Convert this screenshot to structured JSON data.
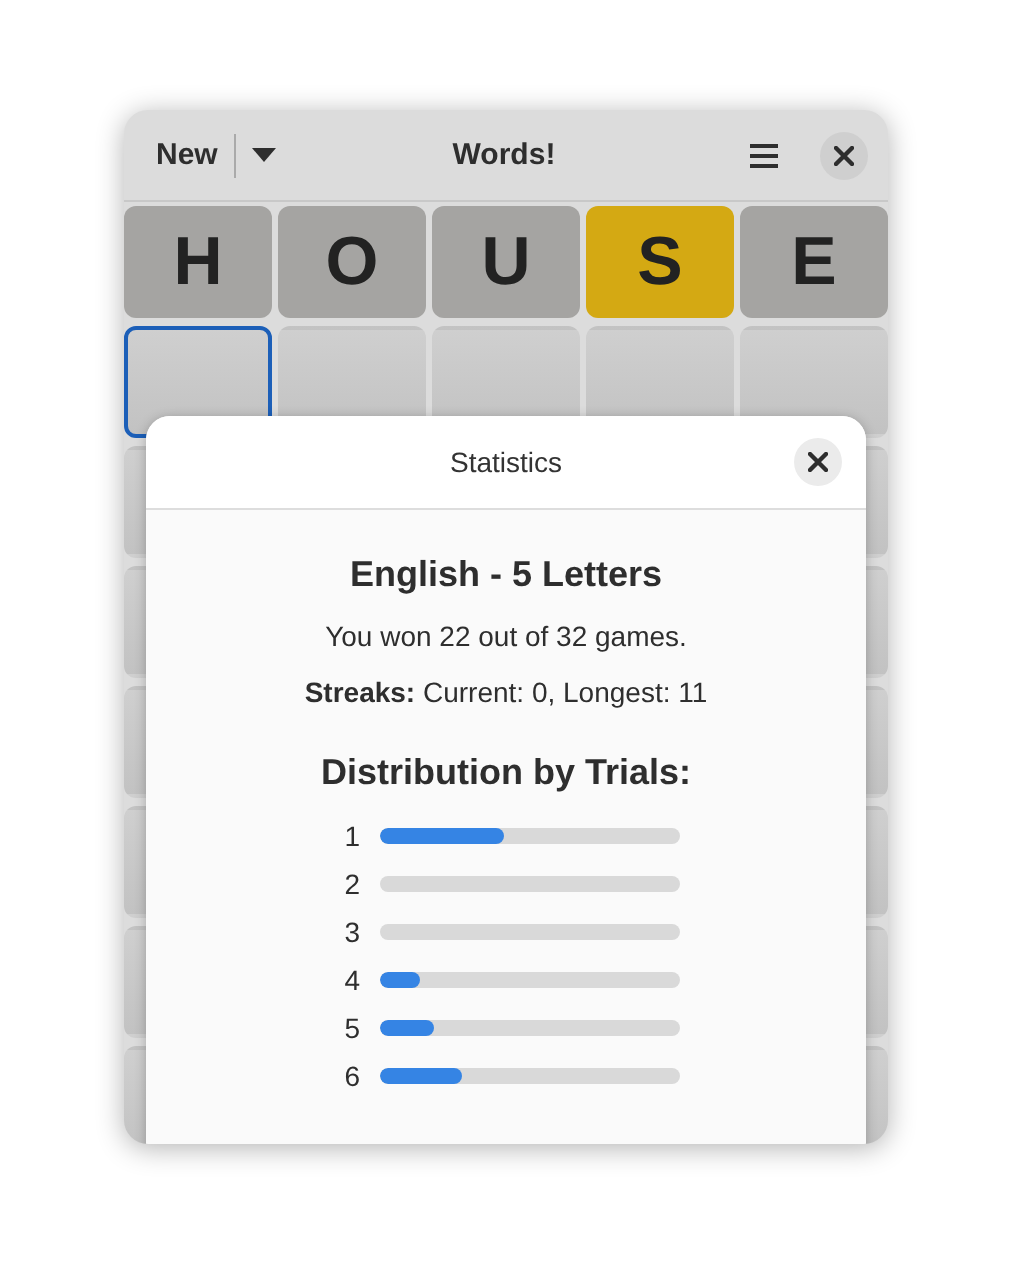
{
  "header": {
    "new_button": "New",
    "title": "Words!"
  },
  "board": {
    "rows": [
      {
        "tiles": [
          {
            "letter": "H",
            "kind": "absent",
            "selected": false
          },
          {
            "letter": "O",
            "kind": "absent",
            "selected": false
          },
          {
            "letter": "U",
            "kind": "absent",
            "selected": false
          },
          {
            "letter": "S",
            "kind": "present",
            "selected": false
          },
          {
            "letter": "E",
            "kind": "absent",
            "selected": false
          }
        ]
      },
      {
        "tiles": [
          {
            "kind": "empty",
            "selected": true
          },
          {
            "kind": "empty",
            "selected": false
          },
          {
            "kind": "empty",
            "selected": false
          },
          {
            "kind": "empty",
            "selected": false
          },
          {
            "kind": "empty",
            "selected": false
          }
        ]
      }
    ]
  },
  "dialog": {
    "title": "Statistics",
    "heading": "English - 5 Letters",
    "summary": "You won 22 out of 32 games.",
    "streaks": "**Streaks:** Current: 0, Longest: 11",
    "distribution_title": "Distribution by Trials:",
    "distribution": [
      {
        "label": "1",
        "level": 0.41
      },
      {
        "label": "2"
      },
      {
        "label": "3"
      },
      {
        "label": "4",
        "level": 0.13
      },
      {
        "label": "5",
        "level": 0.18
      },
      {
        "label": "6",
        "level": 0.27
      }
    ]
  }
}
